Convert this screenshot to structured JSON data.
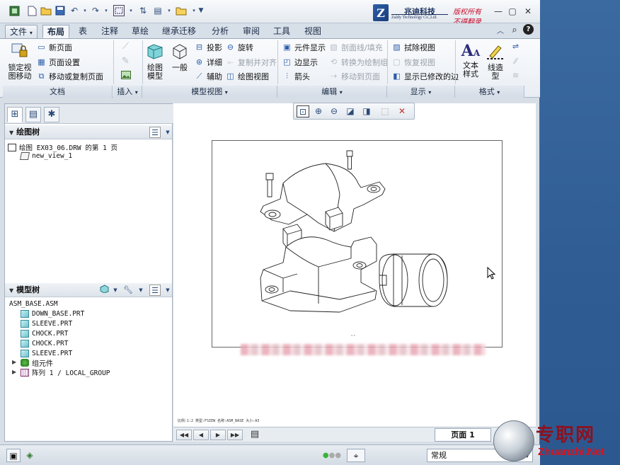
{
  "titlebar": {
    "quick_access": [
      "app-icon",
      "new-icon",
      "open-icon",
      "save-icon",
      "undo-icon",
      "redo-icon",
      "select-box-icon",
      "regenerate-icon",
      "windows-icon",
      "close-window-icon",
      "customize-icon"
    ],
    "logo": {
      "mark": "Z",
      "company_cn": "兆迪科技",
      "company_en": "Zaldy Technology Co.,Ltd.",
      "copyright_line1": "版权所有",
      "copyright_line2": "不得翻录"
    }
  },
  "tabs": [
    {
      "label": "文件"
    },
    {
      "label": "布局",
      "active": true
    },
    {
      "label": "表"
    },
    {
      "label": "注释"
    },
    {
      "label": "草绘"
    },
    {
      "label": "继承迁移"
    },
    {
      "label": "分析"
    },
    {
      "label": "审阅"
    },
    {
      "label": "工具"
    },
    {
      "label": "视图"
    }
  ],
  "ribbon": {
    "document": {
      "lock_view": "锁定视图移动",
      "new_page": "新页面",
      "page_setup": "页面设置",
      "move_copy_page": "移动或复制页面",
      "label": "文档"
    },
    "insert": {
      "label": "插入"
    },
    "model_views": {
      "drawing_model": "绘图模型",
      "general": "一般",
      "projection": "投影",
      "detailed": "详细",
      "auxiliary": "辅助",
      "revolve": "旋转",
      "copy_align": "复制并对齐",
      "drawing_view": "绘图视图",
      "label": "模型视图"
    },
    "edit": {
      "component_display": "元件显示",
      "edge_display": "边显示",
      "arrow": "箭头",
      "section_fill": "剖面线/填充",
      "convert_drawing": "转换为绘制组",
      "move_to_page": "移动到页面",
      "label": "编辑"
    },
    "display": {
      "erase_view": "拭除视图",
      "restore_view": "恢复视图",
      "show_modified_edges": "显示已修改的边",
      "label": "显示"
    },
    "format": {
      "text_style": "文本样式",
      "line_style": "线造型",
      "label": "格式"
    }
  },
  "drawing_tree": {
    "title": "绘图树",
    "items": [
      {
        "label": "绘图 EX03_06.DRW 的第 1 页"
      },
      {
        "label": "new_view_1"
      }
    ]
  },
  "model_tree": {
    "title": "模型树",
    "root": "ASM_BASE.ASM",
    "items": [
      {
        "label": "DOWN_BASE.PRT"
      },
      {
        "label": "SLEEVE.PRT"
      },
      {
        "label": "CHOCK.PRT"
      },
      {
        "label": "CHOCK.PRT"
      },
      {
        "label": "SLEEVE.PRT"
      }
    ],
    "groups": [
      {
        "label": "组元件"
      },
      {
        "label": "阵列 1 / LOCAL_GROUP"
      }
    ]
  },
  "graphics": {
    "status_info": "比例:1:2    类型:FSIEW    名称:ASM_BASE    大小:A3"
  },
  "pagebar": {
    "page_tab": "页面 1"
  },
  "statusbar": {
    "filter_value": "常规"
  },
  "watermark": {
    "cn": "专职网",
    "en": "Zhuanzhi.Net"
  }
}
